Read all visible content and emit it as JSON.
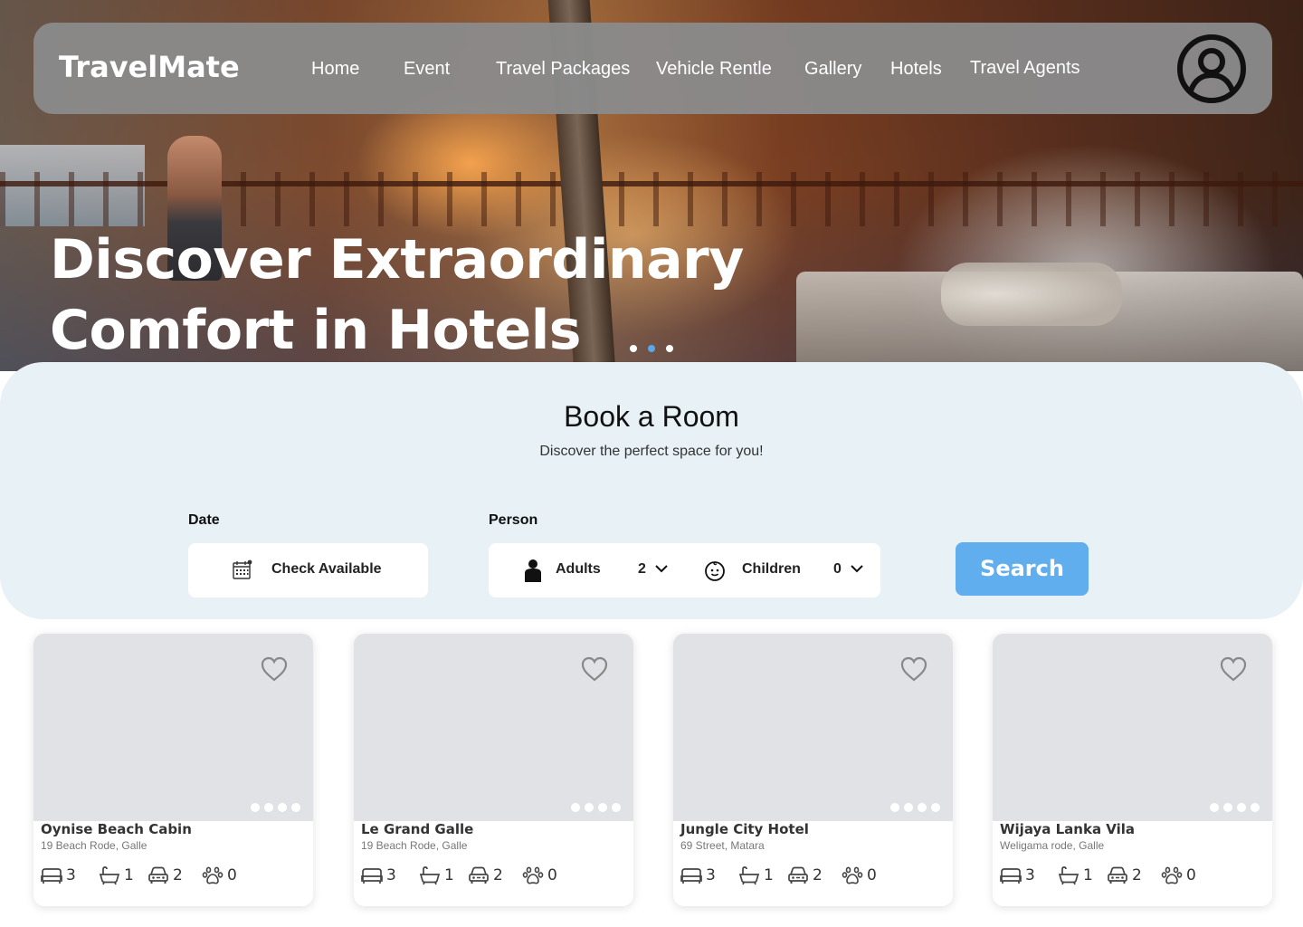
{
  "nav": {
    "brand": "TravelMate",
    "links": [
      "Home",
      "Event",
      "Travel Packages",
      "Vehicle Rentle",
      "Gallery",
      "Hotels",
      "Travel Agents"
    ]
  },
  "hero": {
    "title_line1": "Discover Extraordinary",
    "title_line2": "Comfort in Hotels",
    "carousel": {
      "total": 3,
      "active": 2
    }
  },
  "booking": {
    "title": "Book a Room",
    "subtitle": "Discover the perfect space for you!",
    "date_label": "Date",
    "date_value": "Check Available",
    "person_label": "Person",
    "adults_label": "Adults",
    "adults_value": "2",
    "children_label": "Children",
    "children_value": "0",
    "search_label": "Search"
  },
  "colors": {
    "accent": "#60aeee",
    "booking_bg": "#e7f1f6",
    "nav_bg": "#8a8a8a"
  },
  "hotels": [
    {
      "name": "Oynise Beach Cabin",
      "address": "19 Beach Rode, Galle",
      "beds": "3",
      "baths": "1",
      "parking": "2",
      "pets": "0"
    },
    {
      "name": "Le Grand Galle",
      "address": "19 Beach Rode, Galle",
      "beds": "3",
      "baths": "1",
      "parking": "2",
      "pets": "0"
    },
    {
      "name": "Jungle City Hotel",
      "address": "69 Street, Matara",
      "beds": "3",
      "baths": "1",
      "parking": "2",
      "pets": "0"
    },
    {
      "name": "Wijaya Lanka Vila",
      "address": "Weligama rode, Galle",
      "beds": "3",
      "baths": "1",
      "parking": "2",
      "pets": "0"
    }
  ],
  "icons": {
    "profile": "user-circle-icon",
    "calendar": "calendar-icon",
    "adult": "person-icon",
    "child": "baby-face-icon",
    "favorite": "heart-icon",
    "bed": "bed-icon",
    "bath": "bathtub-icon",
    "car": "car-icon",
    "pet": "paw-icon"
  }
}
